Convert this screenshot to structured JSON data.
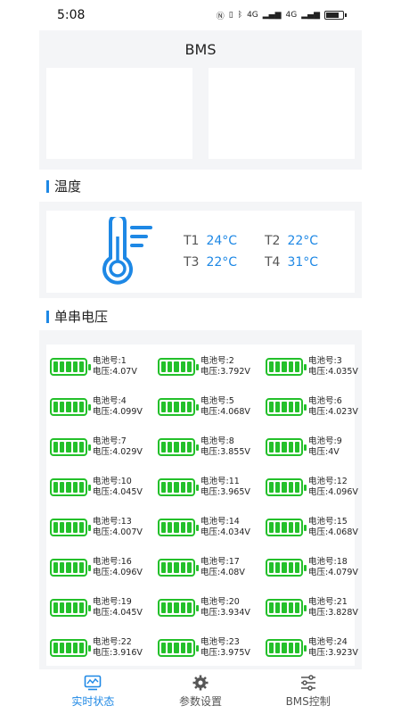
{
  "status_bar": {
    "time": "5:08",
    "network_1": "4G",
    "network_2": "4G"
  },
  "header": {
    "title": "BMS"
  },
  "temperature": {
    "section_title": "温度",
    "sensors": [
      {
        "label": "T1",
        "value": "24°C"
      },
      {
        "label": "T2",
        "value": "22°C"
      },
      {
        "label": "T3",
        "value": "22°C"
      },
      {
        "label": "T4",
        "value": "31°C"
      }
    ]
  },
  "cells": {
    "section_title": "单串电压",
    "items": [
      {
        "num": "电池号:1",
        "volt": "电压:4.07V"
      },
      {
        "num": "电池号:2",
        "volt": "电压:3.792V"
      },
      {
        "num": "电池号:3",
        "volt": "电压:4.035V"
      },
      {
        "num": "电池号:4",
        "volt": "电压:4.099V"
      },
      {
        "num": "电池号:5",
        "volt": "电压:4.068V"
      },
      {
        "num": "电池号:6",
        "volt": "电压:4.023V"
      },
      {
        "num": "电池号:7",
        "volt": "电压:4.029V"
      },
      {
        "num": "电池号:8",
        "volt": "电压:3.855V"
      },
      {
        "num": "电池号:9",
        "volt": "电压:4V"
      },
      {
        "num": "电池号:10",
        "volt": "电压:4.045V"
      },
      {
        "num": "电池号:11",
        "volt": "电压:3.965V"
      },
      {
        "num": "电池号:12",
        "volt": "电压:4.096V"
      },
      {
        "num": "电池号:13",
        "volt": "电压:4.007V"
      },
      {
        "num": "电池号:14",
        "volt": "电压:4.034V"
      },
      {
        "num": "电池号:15",
        "volt": "电压:4.068V"
      },
      {
        "num": "电池号:16",
        "volt": "电压:4.096V"
      },
      {
        "num": "电池号:17",
        "volt": "电压:4.08V"
      },
      {
        "num": "电池号:18",
        "volt": "电压:4.079V"
      },
      {
        "num": "电池号:19",
        "volt": "电压:4.045V"
      },
      {
        "num": "电池号:20",
        "volt": "电压:3.934V"
      },
      {
        "num": "电池号:21",
        "volt": "电压:3.828V"
      },
      {
        "num": "电池号:22",
        "volt": "电压:3.916V"
      },
      {
        "num": "电池号:23",
        "volt": "电压:3.975V"
      },
      {
        "num": "电池号:24",
        "volt": "电压:3.923V"
      }
    ]
  },
  "bottom_nav": {
    "items": [
      {
        "label": "实时状态",
        "icon": "chart-monitor-icon",
        "active": true
      },
      {
        "label": "参数设置",
        "icon": "gear-icon",
        "active": false
      },
      {
        "label": "BMS控制",
        "icon": "sliders-icon",
        "active": false
      }
    ]
  },
  "colors": {
    "accent": "#1e88e5",
    "battery_green": "#23c02a",
    "background": "#f4f5f7"
  }
}
